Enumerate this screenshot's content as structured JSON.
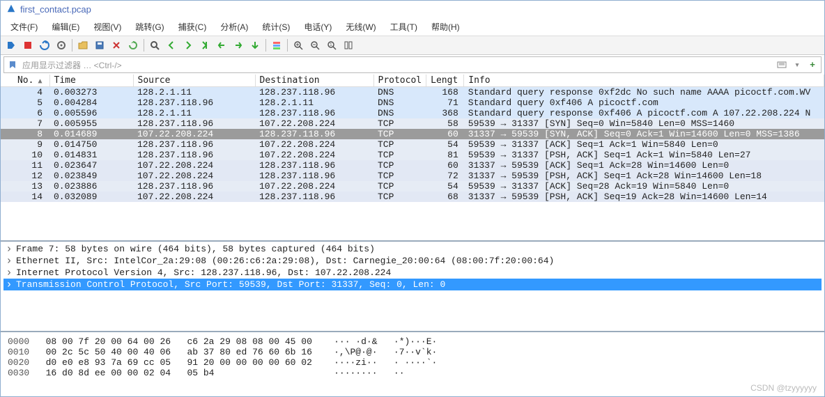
{
  "title": "first_contact.pcap",
  "menus": [
    "文件(F)",
    "编辑(E)",
    "视图(V)",
    "跳转(G)",
    "捕获(C)",
    "分析(A)",
    "统计(S)",
    "电话(Y)",
    "无线(W)",
    "工具(T)",
    "帮助(H)"
  ],
  "filter": {
    "placeholder": "应用显示过滤器 … <Ctrl-/>"
  },
  "columns": [
    "No.",
    "Time",
    "Source",
    "Destination",
    "Protocol",
    "Lengt",
    "Info"
  ],
  "rows": [
    {
      "no": "4",
      "time": "0.003273",
      "src": "128.2.1.11",
      "dst": "128.237.118.96",
      "proto": "DNS",
      "len": "168",
      "info": "Standard query response 0xf2dc No such name AAAA picoctf.com.WV",
      "cls": "dns"
    },
    {
      "no": "5",
      "time": "0.004284",
      "src": "128.237.118.96",
      "dst": "128.2.1.11",
      "proto": "DNS",
      "len": "71",
      "info": "Standard query 0xf406 A picoctf.com",
      "cls": "dns"
    },
    {
      "no": "6",
      "time": "0.005596",
      "src": "128.2.1.11",
      "dst": "128.237.118.96",
      "proto": "DNS",
      "len": "368",
      "info": "Standard query response 0xf406 A picoctf.com A 107.22.208.224 N",
      "cls": "dns"
    },
    {
      "no": "7",
      "time": "0.005955",
      "src": "128.237.118.96",
      "dst": "107.22.208.224",
      "proto": "TCP",
      "len": "58",
      "info": "59539 → 31337 [SYN] Seq=0 Win=5840 Len=0 MSS=1460",
      "cls": "tcp"
    },
    {
      "no": "8",
      "time": "0.014689",
      "src": "107.22.208.224",
      "dst": "128.237.118.96",
      "proto": "TCP",
      "len": "60",
      "info": "31337 → 59539 [SYN, ACK] Seq=0 Ack=1 Win=14600 Len=0 MSS=1386",
      "cls": "selected"
    },
    {
      "no": "9",
      "time": "0.014750",
      "src": "128.237.118.96",
      "dst": "107.22.208.224",
      "proto": "TCP",
      "len": "54",
      "info": "59539 → 31337 [ACK] Seq=1 Ack=1 Win=5840 Len=0",
      "cls": "tcp"
    },
    {
      "no": "10",
      "time": "0.014831",
      "src": "128.237.118.96",
      "dst": "107.22.208.224",
      "proto": "TCP",
      "len": "81",
      "info": "59539 → 31337 [PSH, ACK] Seq=1 Ack=1 Win=5840 Len=27",
      "cls": "tcp"
    },
    {
      "no": "11",
      "time": "0.023647",
      "src": "107.22.208.224",
      "dst": "128.237.118.96",
      "proto": "TCP",
      "len": "60",
      "info": "31337 → 59539 [ACK] Seq=1 Ack=28 Win=14600 Len=0",
      "cls": "tcp2"
    },
    {
      "no": "12",
      "time": "0.023849",
      "src": "107.22.208.224",
      "dst": "128.237.118.96",
      "proto": "TCP",
      "len": "72",
      "info": "31337 → 59539 [PSH, ACK] Seq=1 Ack=28 Win=14600 Len=18",
      "cls": "tcp2"
    },
    {
      "no": "13",
      "time": "0.023886",
      "src": "128.237.118.96",
      "dst": "107.22.208.224",
      "proto": "TCP",
      "len": "54",
      "info": "59539 → 31337 [ACK] Seq=28 Ack=19 Win=5840 Len=0",
      "cls": "tcp"
    },
    {
      "no": "14",
      "time": "0.032089",
      "src": "107.22.208.224",
      "dst": "128.237.118.96",
      "proto": "TCP",
      "len": "68",
      "info": "31337 → 59539 [PSH, ACK] Seq=19 Ack=28 Win=14600 Len=14",
      "cls": "tcp2"
    }
  ],
  "tree": [
    "Frame 7: 58 bytes on wire (464 bits), 58 bytes captured (464 bits)",
    "Ethernet II, Src: IntelCor_2a:29:08 (00:26:c6:2a:29:08), Dst: Carnegie_20:00:64 (08:00:7f:20:00:64)",
    "Internet Protocol Version 4, Src: 128.237.118.96, Dst: 107.22.208.224",
    "Transmission Control Protocol, Src Port: 59539, Dst Port: 31337, Seq: 0, Len: 0"
  ],
  "hex": [
    {
      "off": "0000",
      "bytes": "08 00 7f 20 00 64 00 26   c6 2a 29 08 08 00 45 00",
      "ascii": "··· ·d·&   ·*)···E·"
    },
    {
      "off": "0010",
      "bytes": "00 2c 5c 50 40 00 40 06   ab 37 80 ed 76 60 6b 16",
      "ascii": "·,\\P@·@·   ·7··v`k·"
    },
    {
      "off": "0020",
      "bytes": "d0 e0 e8 93 7a 69 cc 05   91 20 00 00 00 00 60 02",
      "ascii": "····zi··   · ····`·"
    },
    {
      "off": "0030",
      "bytes": "16 d0 8d ee 00 00 02 04   05 b4",
      "ascii": "········   ··"
    }
  ],
  "watermark": "CSDN @tzyyyyyy"
}
